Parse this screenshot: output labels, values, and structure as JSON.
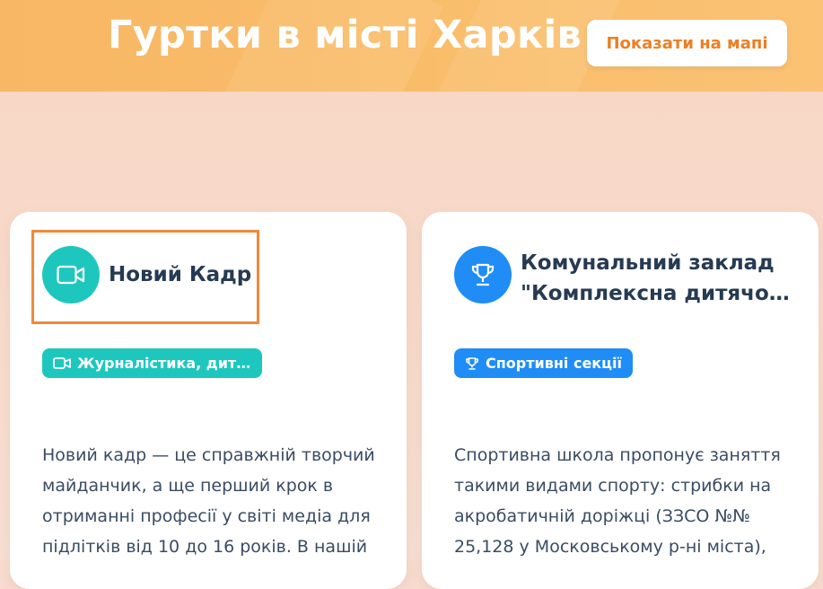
{
  "header": {
    "title": "Гуртки в місті Харків",
    "map_button_label": "Показати на мапі"
  },
  "colors": {
    "accent_orange": "#ee7f22",
    "teal": "#1ec7be",
    "blue": "#1f8df5",
    "text_dark": "#263a52"
  },
  "cards": [
    {
      "icon": "video-camera-icon",
      "title": "Новий Кадр",
      "tag_icon": "video-camera-icon",
      "tag_label": "Журналістика, дитя...",
      "description": "Новий кадр — це справжній творчий майданчик, а ще перший крок в отриманні професії у світі медіа для підлітків від 10 до 16 років. В нашій"
    },
    {
      "icon": "trophy-icon",
      "title_line1": "Комунальний заклад",
      "title_line2": "\"Комплексна дитячо-...",
      "tag_icon": "trophy-icon",
      "tag_label": "Спортивні секції",
      "description": "Спортивна школа пропонує заняття такими видами спорту: стрибки на акробатичній доріжці (ЗЗСО №№ 25,128 у Московському р-ні міста),"
    }
  ]
}
